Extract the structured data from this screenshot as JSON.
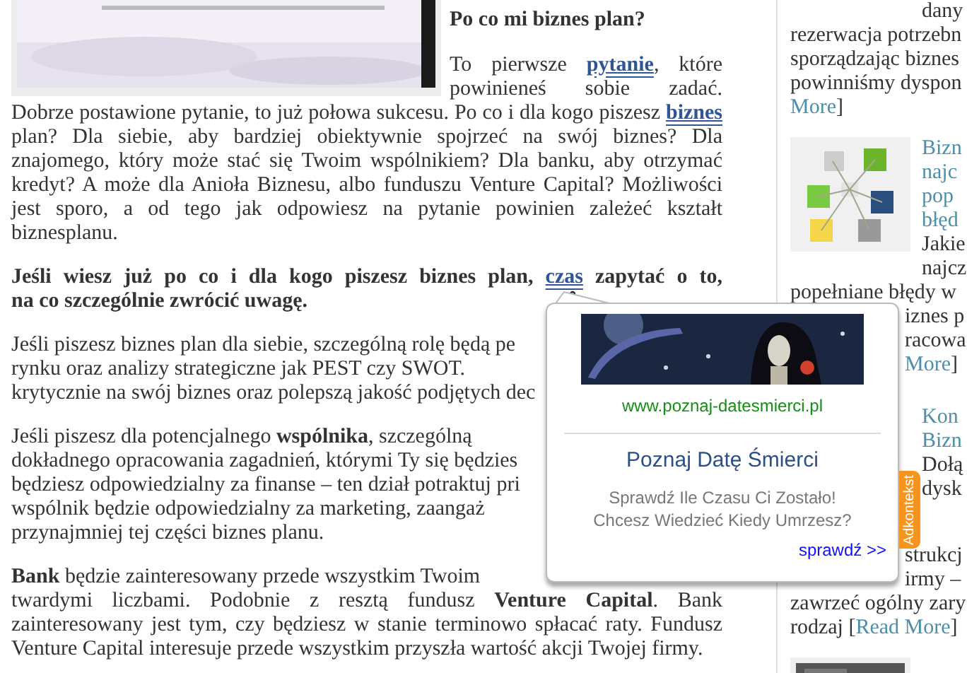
{
  "article": {
    "photo": {
      "kind": "picture"
    },
    "heading": "Po co mi biznes plan?",
    "blocks": [
      {
        "kind": "paragraph",
        "parts": [
          {
            "kind": "text",
            "text": "To pierwsze "
          },
          {
            "kind": "link",
            "text": "pytanie"
          },
          {
            "kind": "text",
            "text": ", które powinieneś sobie zadać. Dobrze postawione pytanie, to już połowa sukcesu. Po co i dla kogo piszesz "
          },
          {
            "kind": "link",
            "text": "biznes"
          },
          {
            "kind": "text",
            "text": " plan? Dla siebie, aby bardziej obiektywnie spojrzeć na swój biznes? Dla znajomego, który może stać się Twoim wspólnikiem? Dla banku, aby otrzymać kredyt? A może dla Anioła Biznesu, albo funduszu Venture Capital? Możliwości jest sporo, a od tego jak odpowiesz na pytanie powinien zależeć kształt biznesplanu."
          }
        ]
      },
      {
        "kind": "lead",
        "lines": [
          {
            "parts": [
              {
                "kind": "text",
                "text": "Jeśli wiesz już po co i dla kogo piszesz biznes plan, "
              },
              {
                "kind": "link",
                "text": "czas"
              },
              {
                "kind": "text",
                "text": " zapytać o to,"
              }
            ]
          },
          {
            "parts": [
              {
                "kind": "text",
                "text": "na co szczególnie zwrócić uwagę."
              }
            ]
          }
        ]
      },
      {
        "kind": "lines",
        "lines": [
          "Jeśli piszesz biznes plan dla siebie, szczególną rolę będą pe",
          "rynku oraz analizy strategiczne jak PEST czy SWOT.",
          "krytycznie na swój biznes oraz polepszą jakość podjętych dec"
        ]
      },
      {
        "kind": "lines",
        "lines": [
          "Jeśli piszesz dla potencjalnego **wspólnika**, szczególną",
          "dokładnego opracowania zagadnień, którymi Ty się będzies",
          "będziesz odpowiedzialny za finanse – ten dział potraktuj pri",
          "wspólnik będzie odpowiedzialny za marketing, zaangaż"
        ],
        "tail": "przynajmniej tej części biznes planu."
      },
      {
        "kind": "lines",
        "lines": [
          "**Bank** będzie zainteresowany przede wszystkim Twoim"
        ],
        "tail": "twardymi liczbami. Podobnie z resztą fundusz **Venture Capital**. Bank zainteresowany jest tym, czy będziesz w stanie terminowo spłacać raty. Fundusz Venture Capital interesuje przede wszystkim przyszła wartość akcji Twojej firmy."
      }
    ]
  },
  "sidebar": {
    "posts": [
      {
        "excerpt": [
          [
            {
              "text": "dany",
              "kind": "beside-thumb"
            },
            {
              "text": "rezerwacja potrzebn",
              "kind": "plain"
            },
            {
              "text": "sporządzając biznes",
              "kind": "plain"
            },
            {
              "text": "powinniśmy dyspon",
              "kind": "plain"
            }
          ]
        ],
        "more": {
          "link": "More",
          "after": "]",
          "kind": "plain"
        }
      },
      {
        "thumbnail": {
          "kind": "picture"
        },
        "title_lines": [
          {
            "text": "Bizn",
            "kind": "beside-thumb"
          },
          {
            "text": "najc",
            "kind": "beside-thumb"
          },
          {
            "text": "pop",
            "kind": "beside-thumb"
          },
          {
            "text": "błęd",
            "kind": "beside-thumb"
          }
        ],
        "excerpt": [
          [
            {
              "text": "Jakie",
              "kind": "beside-thumb"
            },
            {
              "text": "najcz",
              "kind": "beside-thumb"
            },
            {
              "text": "popełniane błędy w",
              "kind": "plain"
            },
            {
              "text": "iznes p",
              "kind": "under-popup"
            },
            {
              "text": "racowa",
              "kind": "under-popup"
            }
          ]
        ],
        "more": {
          "link": "More",
          "after": "]",
          "kind": "under-popup"
        }
      },
      {
        "title_lines": [
          {
            "text": "Kon",
            "kind": "beside-thumb"
          },
          {
            "text": "Bizn",
            "kind": "beside-thumb"
          }
        ],
        "excerpt": [
          [
            {
              "text": "Dołą",
              "kind": "beside-thumb"
            },
            {
              "text": "dysk",
              "kind": "beside-thumb"
            }
          ],
          [
            {
              "text": "strukcj",
              "kind": "under-popup"
            },
            {
              "text": "irmy –",
              "kind": "under-popup"
            },
            {
              "text": "zawrzeć ogólny zary",
              "kind": "plain"
            }
          ]
        ],
        "more": {
          "before": "rodzaj [",
          "link": "Read More",
          "after": "]",
          "kind": "plain"
        }
      },
      {
        "thumbnail": {
          "kind": "picture"
        }
      }
    ]
  },
  "popup": {
    "image": {
      "kind": "picture"
    },
    "url": "www.poznaj-datesmierci.pl",
    "title": "Poznaj Datę Śmierci",
    "description": [
      "Sprawdź Ile Czasu Ci Zostało!",
      "Chcesz Wiedzieć Kiedy Umrzesz?"
    ],
    "action": "sprawdź >>",
    "tab": "Adkontekst"
  }
}
